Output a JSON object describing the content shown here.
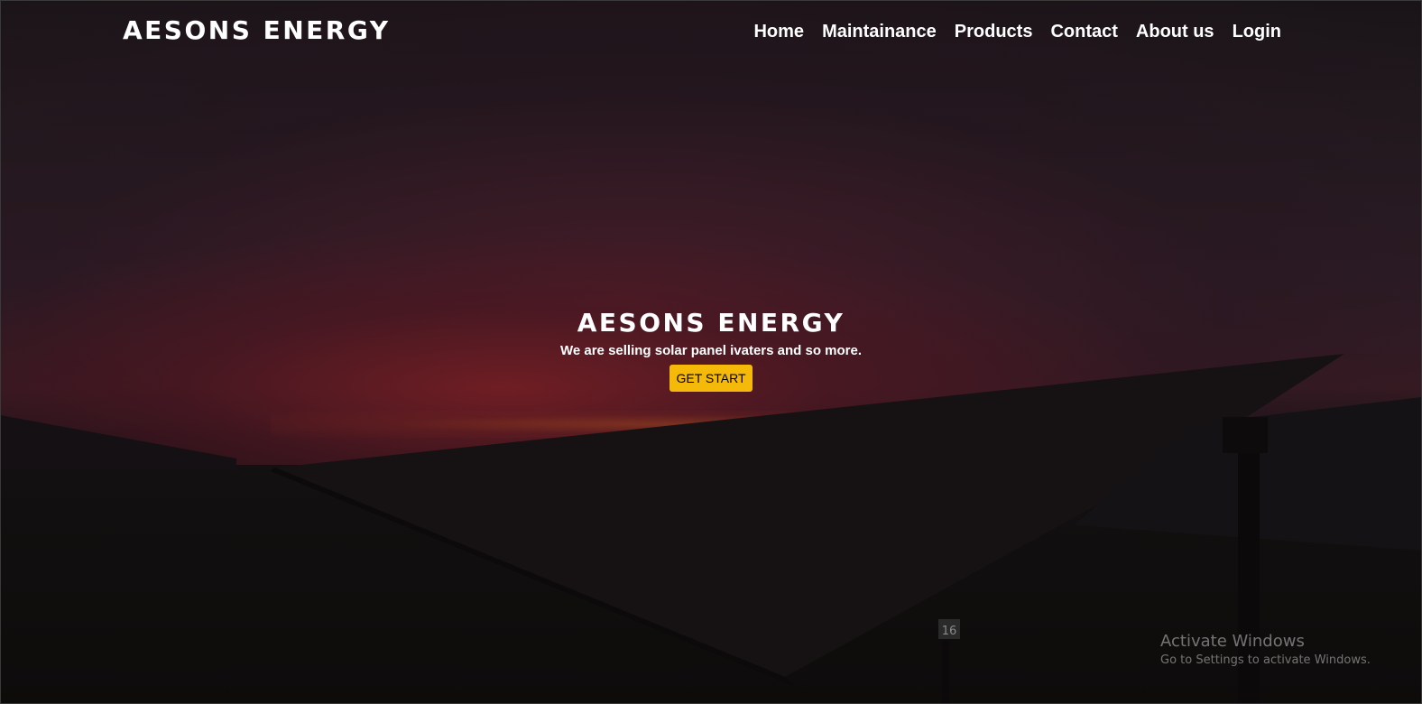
{
  "header": {
    "brand": "AESONS ENERGY",
    "nav": [
      {
        "label": "Home"
      },
      {
        "label": "Maintainance"
      },
      {
        "label": "Products"
      },
      {
        "label": "Contact"
      },
      {
        "label": "About us"
      },
      {
        "label": "Login"
      }
    ]
  },
  "hero": {
    "title": "AESONS ENERGY",
    "subtitle": "We are selling solar panel ivaters and so more.",
    "cta_label": "GET START"
  },
  "scene": {
    "panel_label": "16"
  },
  "watermark": {
    "title": "Activate Windows",
    "subtitle": "Go to Settings to activate Windows."
  },
  "colors": {
    "accent": "#f5b90a",
    "text": "#ffffff"
  }
}
